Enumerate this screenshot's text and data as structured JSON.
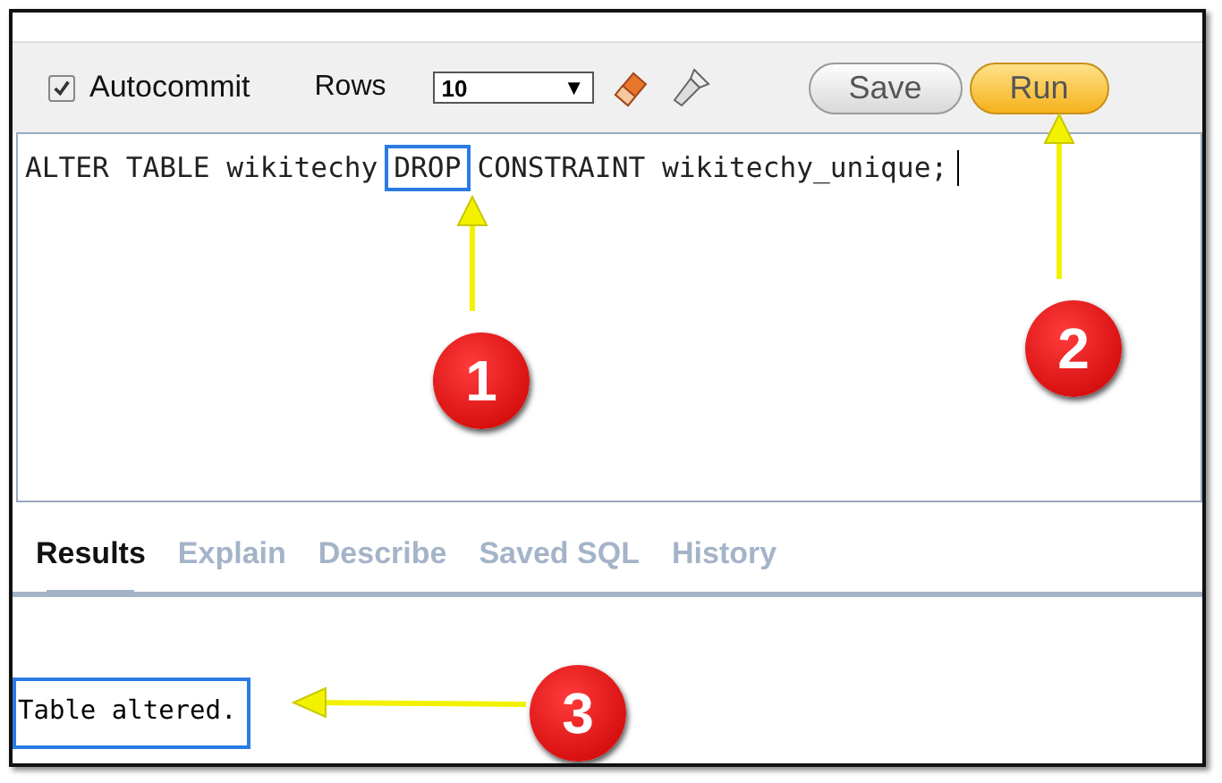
{
  "toolbar": {
    "autocommit": {
      "label": "Autocommit",
      "checked": true
    },
    "rows_label": "Rows",
    "rows_select": {
      "value": "10",
      "arrow": "▼"
    },
    "buttons": [
      {
        "label": "Save",
        "kind": "default"
      },
      {
        "label": "Run",
        "kind": "primary"
      }
    ]
  },
  "editor": {
    "tokens": [
      {
        "text": "ALTER TABLE wikitechy",
        "highlighted": false
      },
      {
        "text": "DROP",
        "highlighted": true
      },
      {
        "text": "CONSTRAINT wikitechy_unique;",
        "highlighted": false
      }
    ]
  },
  "tabs": [
    {
      "label": "Results",
      "selected": true
    },
    {
      "label": "Explain",
      "selected": false
    },
    {
      "label": "Describe",
      "selected": false
    },
    {
      "label": "Saved SQL",
      "selected": false
    },
    {
      "label": "History",
      "selected": false
    }
  ],
  "result": {
    "text": "Table altered.",
    "highlighted": true
  },
  "callouts": [
    {
      "number": "1"
    },
    {
      "number": "2"
    },
    {
      "number": "3"
    }
  ]
}
